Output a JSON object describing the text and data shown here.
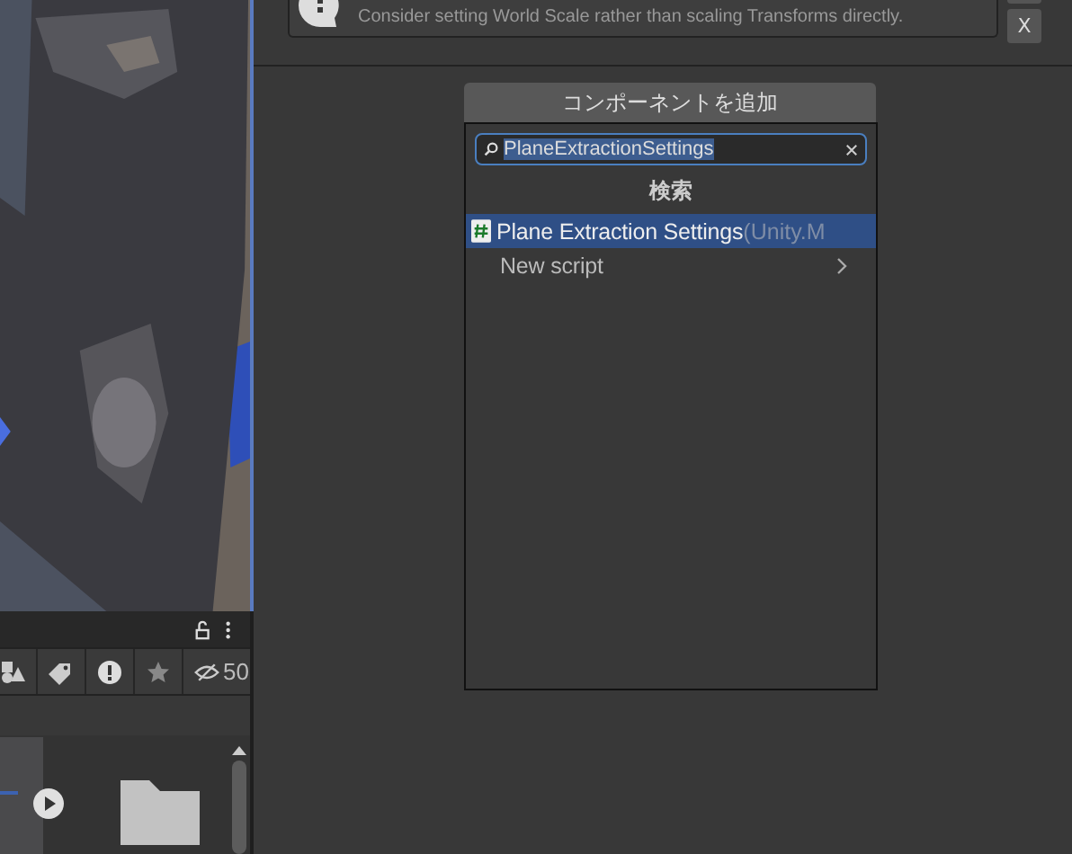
{
  "scene_toolbar": {
    "locked": false
  },
  "filter_bar": {
    "hidden_count": "50"
  },
  "inspector": {
    "help_box": {
      "text": "Consider setting World Scale rather than scaling Transforms directly."
    },
    "side_buttons": [
      {
        "kind": "blank"
      },
      {
        "kind": "label",
        "label": "X"
      }
    ],
    "add_component_button": "コンポーネントを追加",
    "popup": {
      "search": {
        "value": "PlaneExtractionSettings",
        "selected_text": true
      },
      "header": "検索",
      "items": [
        {
          "kind": "script",
          "label": "Plane Extraction Settings",
          "namespace": "(Unity.M",
          "selected": true
        },
        {
          "kind": "submenu",
          "label": "New script",
          "selected": false
        }
      ]
    }
  }
}
